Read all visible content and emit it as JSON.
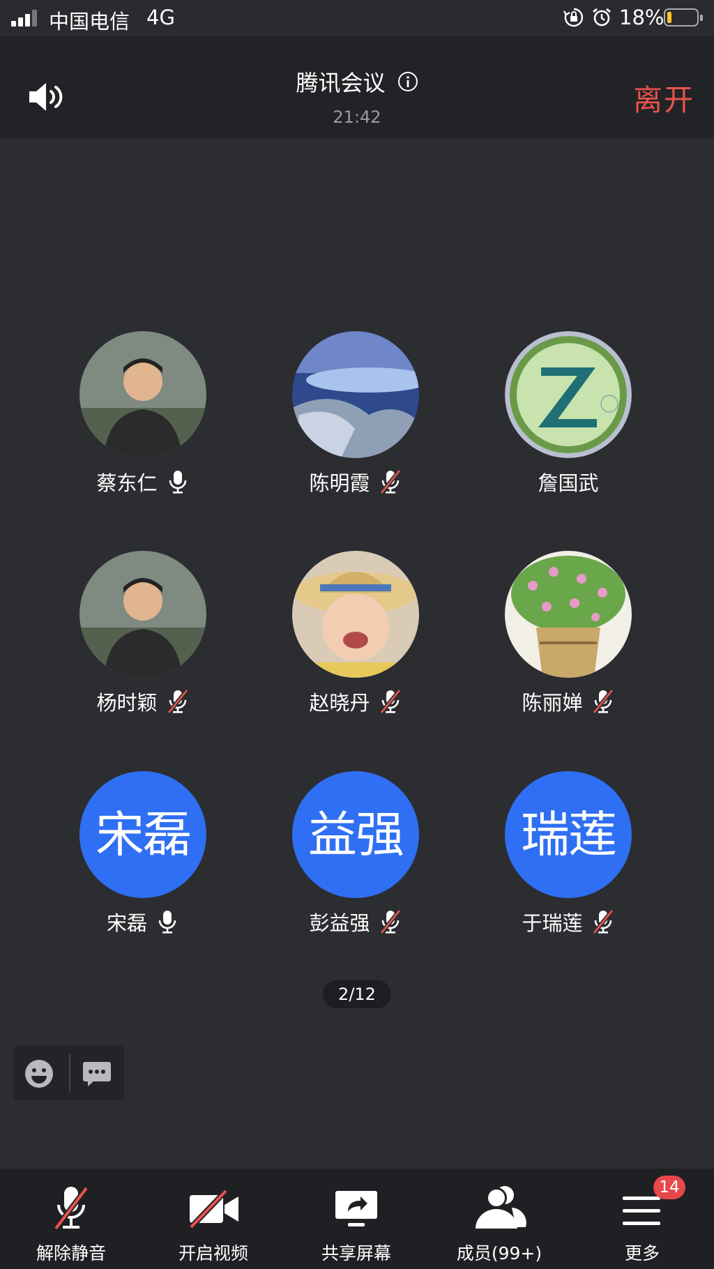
{
  "status_bar": {
    "carrier": "中国电信",
    "network": "4G",
    "battery_text": "18%",
    "battery_level": 0.18,
    "icons": [
      "signal-icon",
      "rotation-lock-icon",
      "alarm-icon",
      "battery-icon"
    ]
  },
  "header": {
    "title": "腾讯会议",
    "time": "21:42",
    "leave_label": "离开",
    "colors": {
      "leave": "#e8534c",
      "background": "#222326"
    }
  },
  "participants": [
    {
      "name": "蔡东仁",
      "mic": "on",
      "avatar": "photo",
      "avatar_icon": "person-photo-avatar"
    },
    {
      "name": "陈明霞",
      "mic": "muted",
      "avatar": "photo",
      "avatar_icon": "lake-landscape-avatar"
    },
    {
      "name": "詹国武",
      "mic": "none",
      "avatar": "photo",
      "avatar_icon": "z-logo-avatar"
    },
    {
      "name": "杨时颖",
      "mic": "muted",
      "avatar": "photo",
      "avatar_icon": "person-photo-avatar"
    },
    {
      "name": "赵晓丹",
      "mic": "muted",
      "avatar": "photo",
      "avatar_icon": "baby-photo-avatar"
    },
    {
      "name": "陈丽婵",
      "mic": "muted",
      "avatar": "photo",
      "avatar_icon": "flower-pot-avatar"
    },
    {
      "name": "宋磊",
      "mic": "on",
      "avatar": "text",
      "avatar_text": "宋磊"
    },
    {
      "name": "彭益强",
      "mic": "muted",
      "avatar": "text",
      "avatar_text": "益强"
    },
    {
      "name": "于瑞莲",
      "mic": "muted",
      "avatar": "text",
      "avatar_text": "瑞莲"
    }
  ],
  "pager": {
    "text": "2/12"
  },
  "toolbar": {
    "unmute": "解除静音",
    "video": "开启视频",
    "share": "共享屏幕",
    "members": "成员(99+)",
    "more": "更多",
    "more_badge": "14"
  },
  "colors": {
    "text_avatar": "#2f6ff3",
    "badge": "#e6484b",
    "mute_slash": "#e8534c"
  }
}
